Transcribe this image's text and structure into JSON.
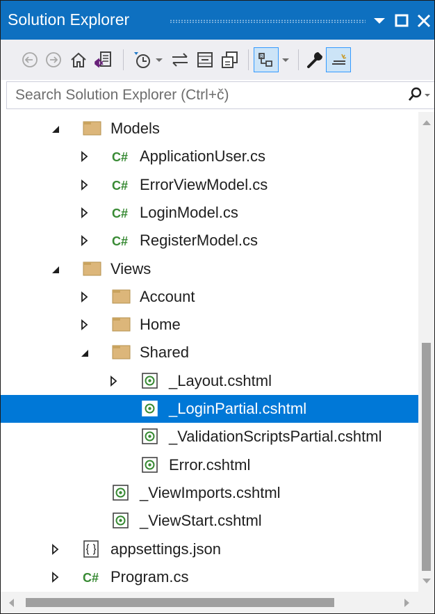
{
  "window": {
    "title": "Solution Explorer"
  },
  "search": {
    "placeholder": "Search Solution Explorer (Ctrl+č)"
  },
  "toolbar": {
    "items": [
      "back",
      "forward",
      "home",
      "switch-views",
      "pending-changes-filter",
      "sync-with-active-document",
      "collapse-all",
      "show-all-files",
      "preview-selected-items",
      "properties",
      "pin-preview"
    ]
  },
  "tree": {
    "items": [
      {
        "label": "Models",
        "type": "folder",
        "expander": "expanded",
        "level": 1
      },
      {
        "label": "ApplicationUser.cs",
        "type": "csharp",
        "expander": "collapsed",
        "level": 2
      },
      {
        "label": "ErrorViewModel.cs",
        "type": "csharp",
        "expander": "collapsed",
        "level": 2
      },
      {
        "label": "LoginModel.cs",
        "type": "csharp",
        "expander": "collapsed",
        "level": 2
      },
      {
        "label": "RegisterModel.cs",
        "type": "csharp",
        "expander": "collapsed",
        "level": 2
      },
      {
        "label": "Views",
        "type": "folder",
        "expander": "expanded",
        "level": 1
      },
      {
        "label": "Account",
        "type": "folder",
        "expander": "collapsed",
        "level": 2
      },
      {
        "label": "Home",
        "type": "folder",
        "expander": "collapsed",
        "level": 2
      },
      {
        "label": "Shared",
        "type": "folder",
        "expander": "expanded",
        "level": 2
      },
      {
        "label": "_Layout.cshtml",
        "type": "razor",
        "expander": "collapsed",
        "level": 3
      },
      {
        "label": "_LoginPartial.cshtml",
        "type": "razor",
        "expander": "none",
        "level": 3,
        "selected": true
      },
      {
        "label": "_ValidationScriptsPartial.cshtml",
        "type": "razor",
        "expander": "none",
        "level": 3
      },
      {
        "label": "Error.cshtml",
        "type": "razor",
        "expander": "none",
        "level": 3
      },
      {
        "label": "_ViewImports.cshtml",
        "type": "razor",
        "expander": "none",
        "level": 2
      },
      {
        "label": "_ViewStart.cshtml",
        "type": "razor",
        "expander": "none",
        "level": 2
      },
      {
        "label": "appsettings.json",
        "type": "json",
        "expander": "collapsed",
        "level": 1
      },
      {
        "label": "Program.cs",
        "type": "csharp",
        "expander": "collapsed",
        "level": 1
      }
    ],
    "csharp_glyph": "C#"
  },
  "colors": {
    "accent": "#0e70c0",
    "selection": "#0078d7",
    "folder": "#dcb67a",
    "csharp": "#388a34",
    "razor": "#388a34"
  }
}
